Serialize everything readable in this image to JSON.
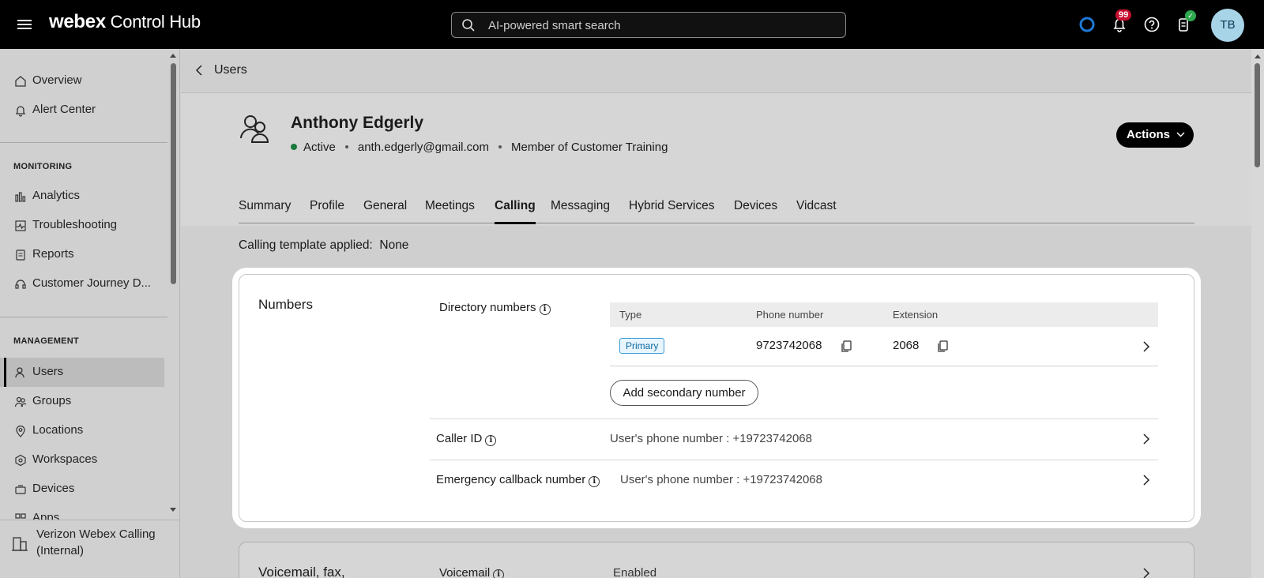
{
  "topbar": {
    "brand_bold": "webex",
    "brand_rest": " Control Hub",
    "search_placeholder": "AI-powered smart search",
    "notification_count": "99",
    "avatar_initials": "TB"
  },
  "sidebar": {
    "items_top": [
      {
        "label": "Overview",
        "icon": "home-icon"
      },
      {
        "label": "Alert Center",
        "icon": "bell-icon"
      }
    ],
    "monitoring_label": "MONITORING",
    "monitoring_items": [
      {
        "label": "Analytics",
        "icon": "analytics-icon"
      },
      {
        "label": "Troubleshooting",
        "icon": "troubleshooting-icon"
      },
      {
        "label": "Reports",
        "icon": "reports-icon"
      },
      {
        "label": "Customer Journey D...",
        "icon": "headset-icon"
      }
    ],
    "management_label": "MANAGEMENT",
    "management_items": [
      {
        "label": "Users",
        "icon": "user-icon",
        "active": true
      },
      {
        "label": "Groups",
        "icon": "groups-icon"
      },
      {
        "label": "Locations",
        "icon": "location-pin-icon"
      },
      {
        "label": "Workspaces",
        "icon": "workspace-icon"
      },
      {
        "label": "Devices",
        "icon": "device-icon"
      },
      {
        "label": "Apps",
        "icon": "apps-icon"
      }
    ],
    "org_name": "Verizon Webex Calling (Internal)"
  },
  "main": {
    "back_label": "Users",
    "user": {
      "name": "Anthony Edgerly",
      "status": "Active",
      "email": "anth.edgerly@gmail.com",
      "membership": "Member of Customer Training"
    },
    "actions_label": "Actions",
    "tabs": [
      "Summary",
      "Profile",
      "General",
      "Meetings",
      "Calling",
      "Messaging",
      "Hybrid Services",
      "Devices",
      "Vidcast"
    ],
    "active_tab": "Calling",
    "template_label": "Calling template applied:",
    "template_value": "None",
    "numbers_card": {
      "title": "Numbers",
      "directory_label": "Directory numbers",
      "columns": [
        "Type",
        "Phone number",
        "Extension"
      ],
      "row": {
        "type": "Primary",
        "phone": "9723742068",
        "extension": "2068"
      },
      "add_button": "Add secondary number",
      "caller_id_label": "Caller ID",
      "caller_id_value": "User's phone number : +19723742068",
      "emergency_label": "Emergency callback number",
      "emergency_value": "User's phone number : +19723742068"
    },
    "voicemail_card": {
      "title": "Voicemail, fax,",
      "label": "Voicemail",
      "value": "Enabled"
    }
  },
  "colors": {
    "topbar_bg": "#000000",
    "status_active": "#1a7a3e",
    "badge": "#c8102e",
    "primary_pill": "#3aa0d8"
  }
}
